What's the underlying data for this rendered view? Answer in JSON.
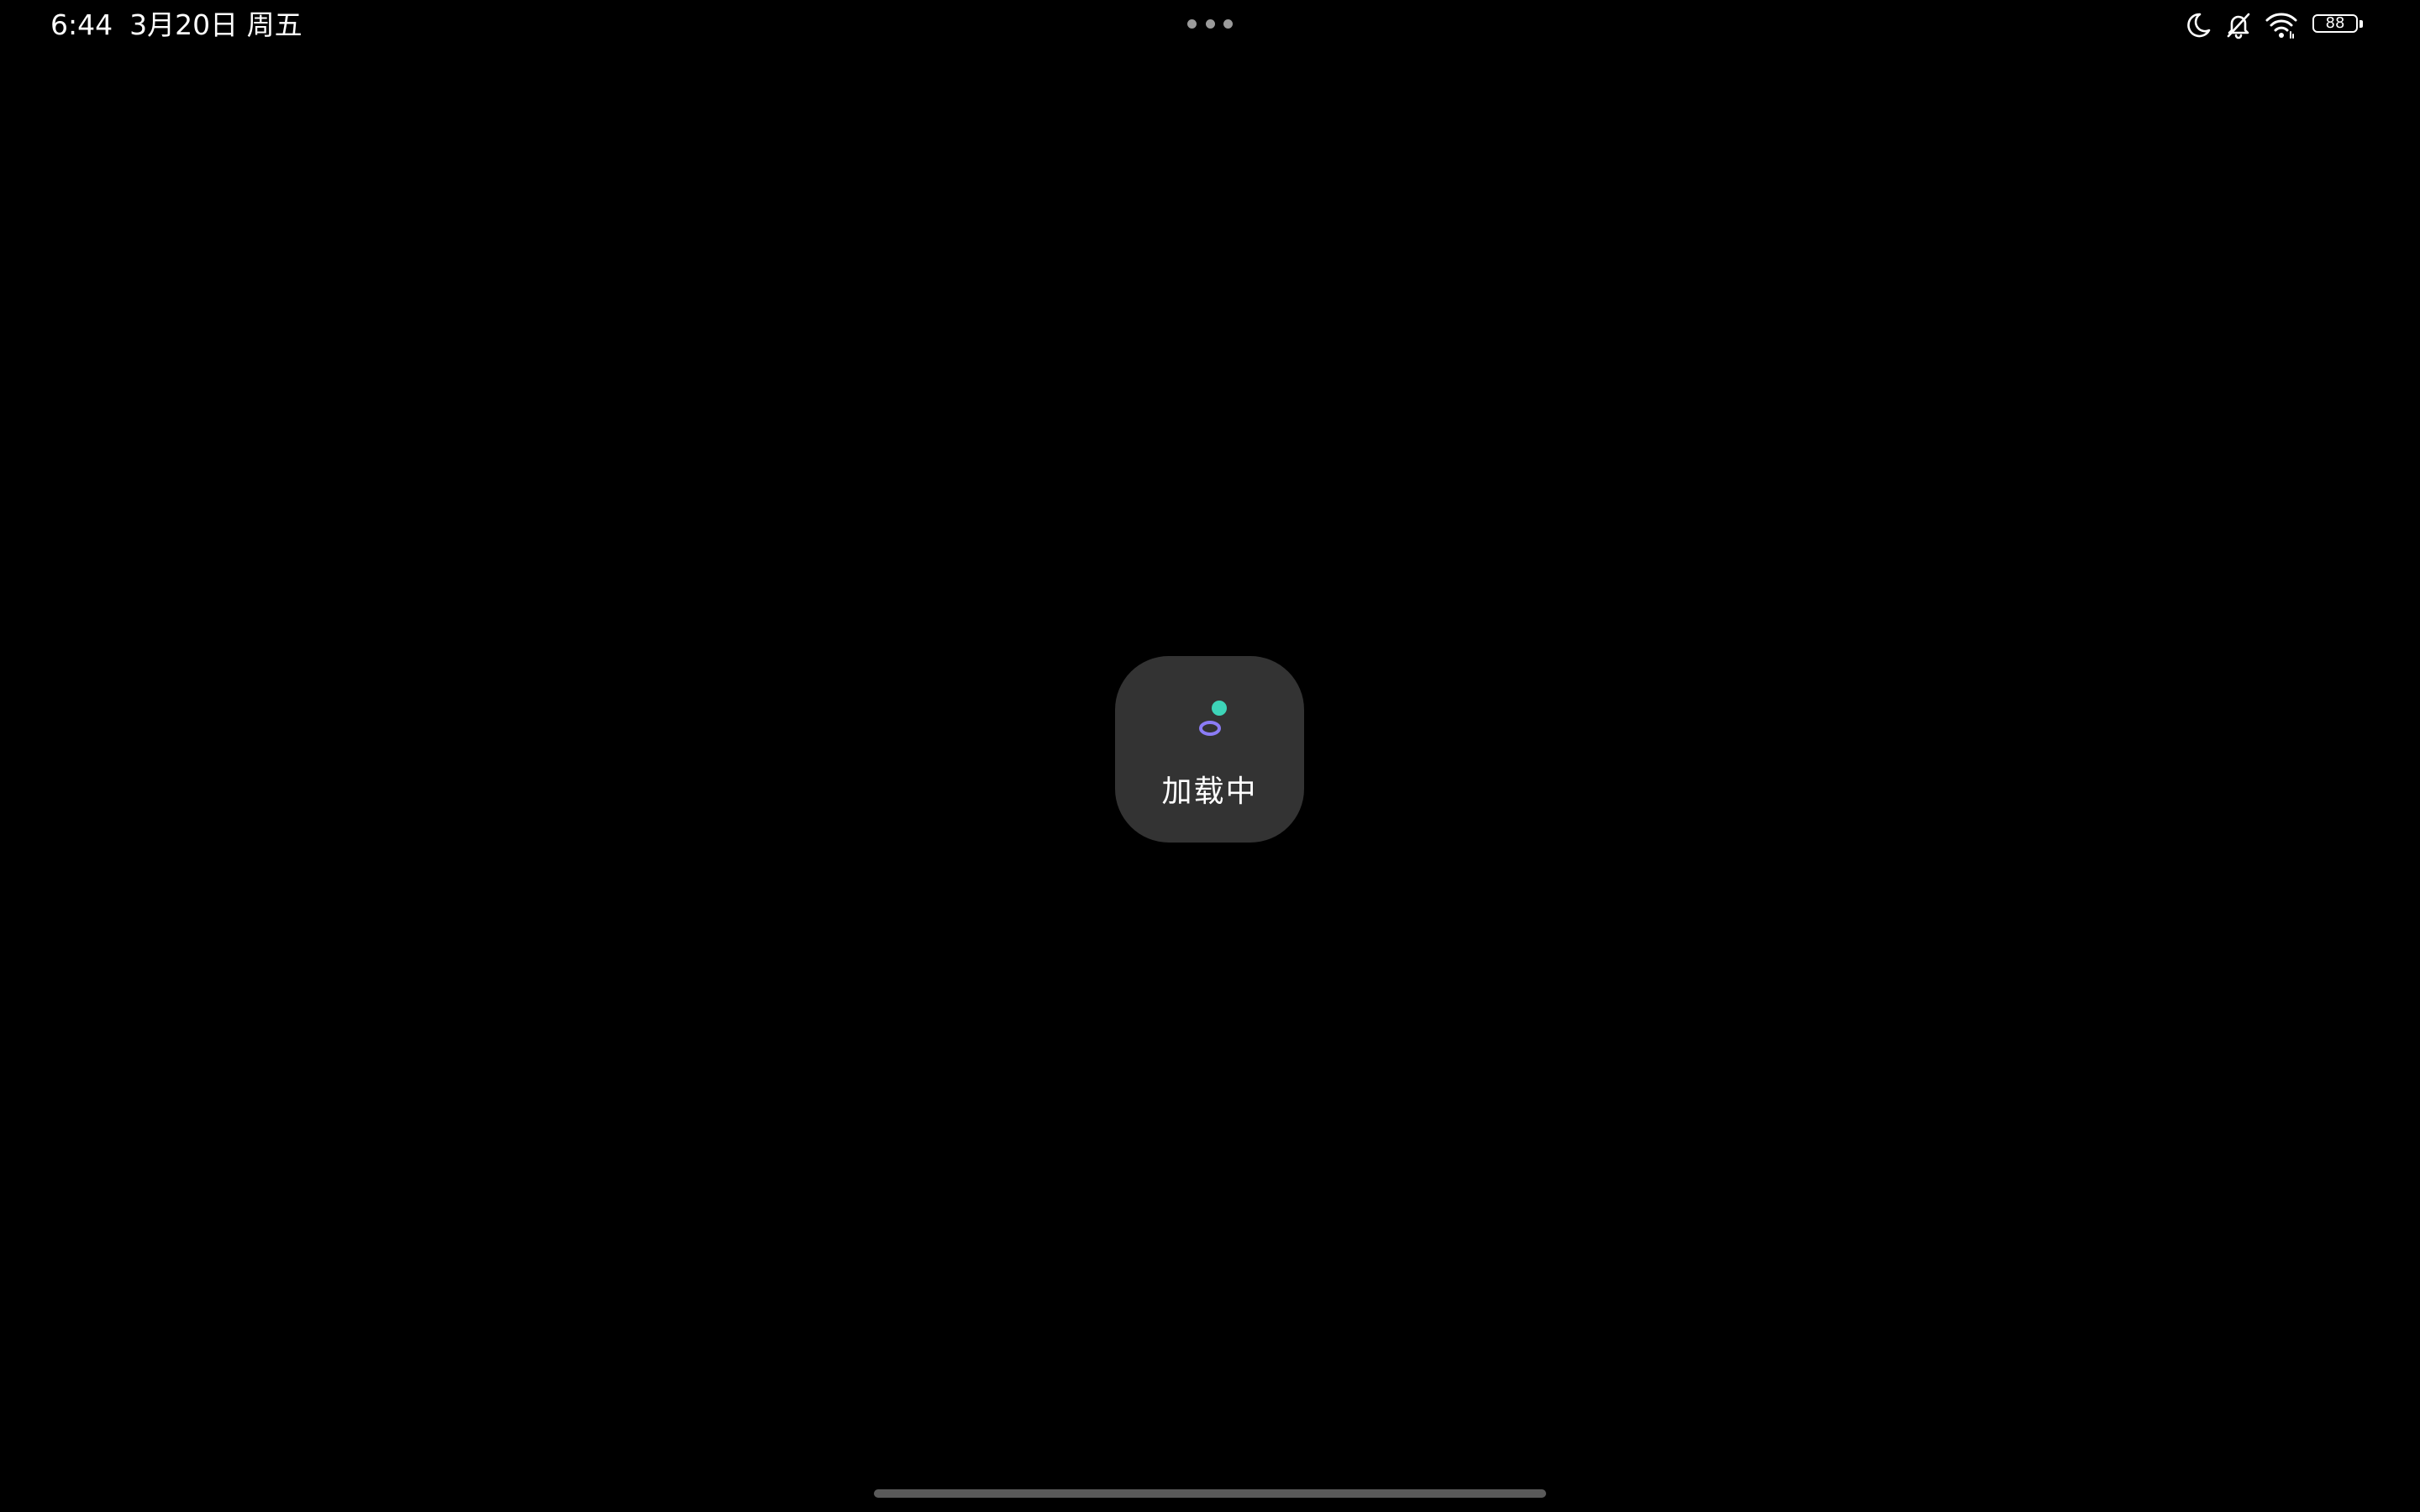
{
  "status_bar": {
    "time": "6:44",
    "date": "3月20日 周五",
    "battery_level": "88",
    "icons": [
      "moon-icon",
      "bell-off-icon",
      "wifi-icon",
      "battery-icon"
    ],
    "more_dots_color": "#9a9a9a"
  },
  "loading": {
    "label": "加载中",
    "dot_color": "#3dd4b8",
    "ring_color": "#8b7cf6",
    "card_color": "#333333"
  },
  "colors": {
    "background": "#000000",
    "home_indicator": "#5a5a5a"
  }
}
